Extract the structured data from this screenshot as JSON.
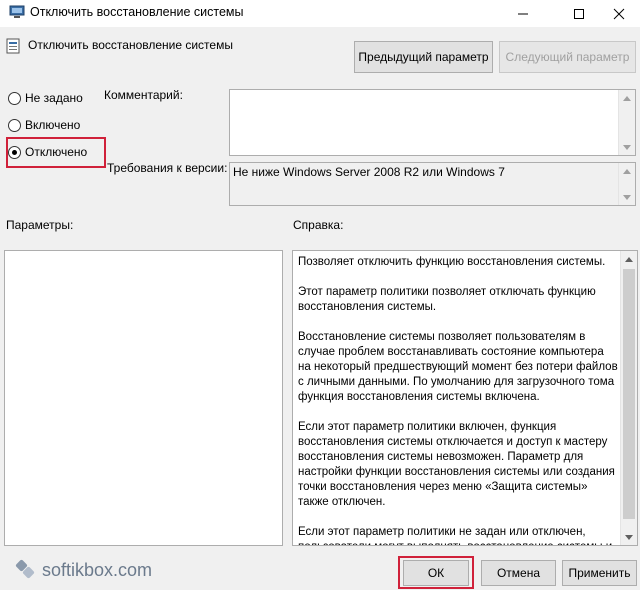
{
  "window": {
    "title": "Отключить восстановление системы",
    "icons": {
      "app": "policy-app-icon",
      "minimize": "minimize-icon",
      "maximize": "maximize-icon",
      "close": "close-icon"
    }
  },
  "header": {
    "policy_name": "Отключить восстановление системы",
    "prev_label": "Предыдущий параметр",
    "next_label": "Следующий параметр"
  },
  "state": {
    "options": [
      "Не задано",
      "Включено",
      "Отключено"
    ],
    "selected": "Отключено"
  },
  "comment": {
    "label": "Комментарий:",
    "value": ""
  },
  "requirements": {
    "label": "Требования к версии:",
    "value": "Не ниже Windows Server 2008 R2 или Windows 7"
  },
  "panes": {
    "params_label": "Параметры:",
    "help_label": "Справка:"
  },
  "help": {
    "p1": "Позволяет отключить функцию восстановления системы.",
    "p2": "Этот параметр политики позволяет отключать функцию восстановления системы.",
    "p3": "Восстановление системы позволяет пользователям в случае проблем восстанавливать состояние компьютера на некоторый предшествующий момент без потери файлов с личными данными. По умолчанию для загрузочного тома функция восстановления системы включена.",
    "p4": "Если этот параметр политики включен, функция восстановления системы отключается и доступ к мастеру восстановления системы невозможен. Параметр для настройки функции восстановления системы или создания точки восстановления через меню «Защита системы» также отключен.",
    "p5": "Если этот параметр политики не задан или отключен, пользователи могут выполнять восстановление системы и"
  },
  "footer": {
    "watermark": "softikbox.com",
    "ok_label": "ОК",
    "cancel_label": "Отмена",
    "apply_label": "Применить"
  },
  "colors": {
    "highlight": "#d0213a",
    "window_bg": "#f0f0f0",
    "button_bg": "#e1e1e1"
  }
}
